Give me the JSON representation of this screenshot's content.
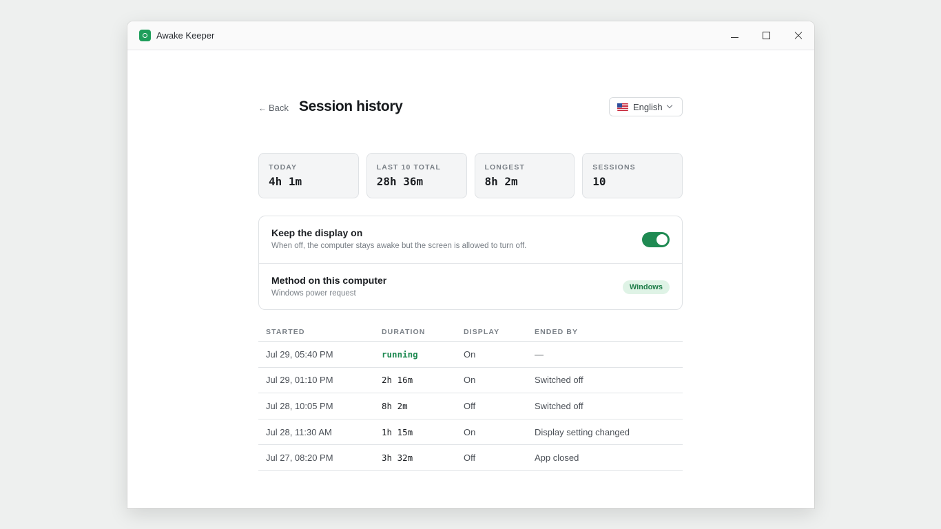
{
  "window": {
    "title": "Awake Keeper"
  },
  "header": {
    "back_label": "Back",
    "page_title": "Session history",
    "language": "English"
  },
  "stats": [
    {
      "label": "TODAY",
      "value": "4h 1m"
    },
    {
      "label": "LAST 10 TOTAL",
      "value": "28h 36m"
    },
    {
      "label": "LONGEST",
      "value": "8h 2m"
    },
    {
      "label": "SESSIONS",
      "value": "10"
    }
  ],
  "settings": {
    "display": {
      "title": "Keep the display on",
      "subtitle": "When off, the computer stays awake but the screen is allowed to turn off.",
      "enabled": true
    },
    "method": {
      "title": "Method on this computer",
      "subtitle": "Windows power request",
      "badge": "Windows"
    }
  },
  "table": {
    "headers": [
      "STARTED",
      "DURATION",
      "DISPLAY",
      "ENDED BY"
    ],
    "rows": [
      {
        "started": "Jul 29, 05:40 PM",
        "duration": "running",
        "display": "On",
        "ended_by": "—"
      },
      {
        "started": "Jul 29, 01:10 PM",
        "duration": "2h 16m",
        "display": "On",
        "ended_by": "Switched off"
      },
      {
        "started": "Jul 28, 10:05 PM",
        "duration": "8h 2m",
        "display": "Off",
        "ended_by": "Switched off"
      },
      {
        "started": "Jul 28, 11:30 AM",
        "duration": "1h 15m",
        "display": "On",
        "ended_by": "Display setting changed"
      },
      {
        "started": "Jul 27, 08:20 PM",
        "duration": "3h 32m",
        "display": "Off",
        "ended_by": "App closed"
      }
    ]
  },
  "colors": {
    "accent": "#1f8a52",
    "badge_bg": "#dff3e6"
  }
}
